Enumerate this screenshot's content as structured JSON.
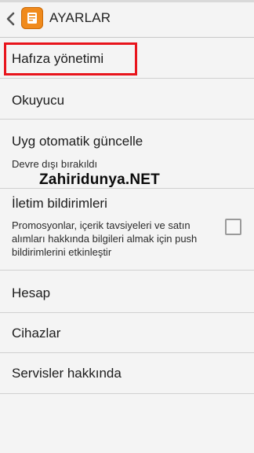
{
  "header": {
    "title": "AYARLAR",
    "back_icon": "chevron-left-icon",
    "app_icon": "app-logo-icon"
  },
  "settings": {
    "memory": {
      "label": "Hafıza yönetimi"
    },
    "reader": {
      "label": "Okuyucu"
    },
    "auto_update": {
      "label": "Uyg otomatik güncelle",
      "value": "Devre dışı bırakıldı"
    },
    "notifications": {
      "label": "İletim bildirimleri",
      "description": "Promosyonlar, içerik tavsiyeleri ve satın alımları hakkında bilgileri almak için push bildirimlerini etkinleştir",
      "checked": false
    },
    "account": {
      "label": "Hesap"
    },
    "devices": {
      "label": "Cihazlar"
    },
    "about": {
      "label": "Servisler hakkında"
    }
  },
  "watermark": "Zahiridunya.NET",
  "colors": {
    "highlight": "#e8141c",
    "app_icon": "#f08a1c"
  }
}
